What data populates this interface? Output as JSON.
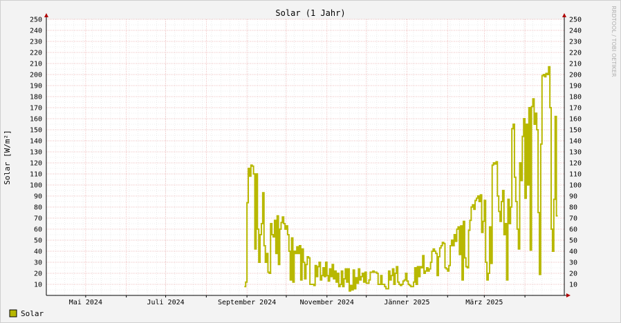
{
  "window": {
    "watermark": "RRDTOOL / TOBI OETIKER"
  },
  "colors": {
    "background": "#f3f3f3",
    "plot_bg": "#ffffff",
    "grid_major": "#e8a0a0",
    "grid_minor": "#dedede",
    "series": "#b8b800",
    "axis": "#000000",
    "arrow": "#b00000"
  },
  "chart_data": {
    "type": "line",
    "title": "Solar (1 Jahr)",
    "xlabel": "",
    "ylabel": "Solar [W/m²]",
    "ylim": [
      0,
      250
    ],
    "xlim": [
      "2024-04-01",
      "2025-05-01"
    ],
    "yticks": [
      10,
      20,
      30,
      40,
      50,
      60,
      70,
      80,
      90,
      100,
      110,
      120,
      130,
      140,
      150,
      160,
      170,
      180,
      190,
      200,
      210,
      220,
      230,
      240,
      250
    ],
    "xticks": [
      {
        "label": "Mai 2024",
        "date": "2024-05-01"
      },
      {
        "label": "Juli 2024",
        "date": "2024-07-01"
      },
      {
        "label": "September 2024",
        "date": "2024-09-01"
      },
      {
        "label": "November 2024",
        "date": "2024-11-01"
      },
      {
        "label": "Jänner 2025",
        "date": "2025-01-01"
      },
      {
        "label": "März 2025",
        "date": "2025-03-01"
      }
    ],
    "grid": true,
    "legend_position": "bottom-left",
    "series": [
      {
        "name": "Solar",
        "color": "#b8b800",
        "points": [
          [
            "2024-08-30",
            8
          ],
          [
            "2024-08-31",
            12
          ],
          [
            "2024-09-01",
            84
          ],
          [
            "2024-09-02",
            115
          ],
          [
            "2024-09-03",
            108
          ],
          [
            "2024-09-04",
            118
          ],
          [
            "2024-09-05",
            117
          ],
          [
            "2024-09-06",
            110
          ],
          [
            "2024-09-07",
            42
          ],
          [
            "2024-09-08",
            110
          ],
          [
            "2024-09-09",
            60
          ],
          [
            "2024-09-10",
            30
          ],
          [
            "2024-09-11",
            55
          ],
          [
            "2024-09-12",
            65
          ],
          [
            "2024-09-13",
            93
          ],
          [
            "2024-09-14",
            45
          ],
          [
            "2024-09-15",
            30
          ],
          [
            "2024-09-16",
            38
          ],
          [
            "2024-09-17",
            21
          ],
          [
            "2024-09-18",
            20
          ],
          [
            "2024-09-19",
            65
          ],
          [
            "2024-09-20",
            55
          ],
          [
            "2024-09-21",
            53
          ],
          [
            "2024-09-22",
            68
          ],
          [
            "2024-09-23",
            38
          ],
          [
            "2024-09-24",
            72
          ],
          [
            "2024-09-25",
            28
          ],
          [
            "2024-09-26",
            60
          ],
          [
            "2024-09-27",
            66
          ],
          [
            "2024-09-28",
            71
          ],
          [
            "2024-09-29",
            65
          ],
          [
            "2024-09-30",
            60
          ],
          [
            "2024-10-01",
            63
          ],
          [
            "2024-10-02",
            55
          ],
          [
            "2024-10-03",
            40
          ],
          [
            "2024-10-04",
            14
          ],
          [
            "2024-10-05",
            52
          ],
          [
            "2024-10-06",
            12
          ],
          [
            "2024-10-07",
            40
          ],
          [
            "2024-10-08",
            38
          ],
          [
            "2024-10-09",
            44
          ],
          [
            "2024-10-10",
            38
          ],
          [
            "2024-10-11",
            45
          ],
          [
            "2024-10-12",
            14
          ],
          [
            "2024-10-13",
            42
          ],
          [
            "2024-10-14",
            30
          ],
          [
            "2024-10-15",
            15
          ],
          [
            "2024-10-16",
            28
          ],
          [
            "2024-10-17",
            35
          ],
          [
            "2024-10-18",
            34
          ],
          [
            "2024-10-19",
            10
          ],
          [
            "2024-10-20",
            10
          ],
          [
            "2024-10-21",
            10
          ],
          [
            "2024-10-22",
            9
          ],
          [
            "2024-10-23",
            27
          ],
          [
            "2024-10-24",
            17
          ],
          [
            "2024-10-25",
            26
          ],
          [
            "2024-10-26",
            30
          ],
          [
            "2024-10-27",
            14
          ],
          [
            "2024-10-28",
            18
          ],
          [
            "2024-10-29",
            25
          ],
          [
            "2024-10-30",
            17
          ],
          [
            "2024-10-31",
            30
          ],
          [
            "2024-11-01",
            18
          ],
          [
            "2024-11-02",
            13
          ],
          [
            "2024-11-03",
            24
          ],
          [
            "2024-11-04",
            17
          ],
          [
            "2024-11-05",
            28
          ],
          [
            "2024-11-06",
            15
          ],
          [
            "2024-11-07",
            22
          ],
          [
            "2024-11-08",
            12
          ],
          [
            "2024-11-09",
            20
          ],
          [
            "2024-11-10",
            8
          ],
          [
            "2024-11-11",
            10
          ],
          [
            "2024-11-12",
            22
          ],
          [
            "2024-11-13",
            8
          ],
          [
            "2024-11-14",
            15
          ],
          [
            "2024-11-15",
            24
          ],
          [
            "2024-11-16",
            12
          ],
          [
            "2024-11-17",
            24
          ],
          [
            "2024-11-18",
            4
          ],
          [
            "2024-11-19",
            9
          ],
          [
            "2024-11-20",
            5
          ],
          [
            "2024-11-21",
            23
          ],
          [
            "2024-11-22",
            6
          ],
          [
            "2024-11-23",
            16
          ],
          [
            "2024-11-24",
            11
          ],
          [
            "2024-11-25",
            24
          ],
          [
            "2024-11-26",
            14
          ],
          [
            "2024-11-27",
            17
          ],
          [
            "2024-11-28",
            20
          ],
          [
            "2024-11-29",
            12
          ],
          [
            "2024-11-30",
            21
          ],
          [
            "2024-12-01",
            11
          ],
          [
            "2024-12-02",
            11
          ],
          [
            "2024-12-03",
            14
          ],
          [
            "2024-12-04",
            21
          ],
          [
            "2024-12-05",
            21
          ],
          [
            "2024-12-06",
            22
          ],
          [
            "2024-12-07",
            21
          ],
          [
            "2024-12-08",
            21
          ],
          [
            "2024-12-09",
            20
          ],
          [
            "2024-12-10",
            10
          ],
          [
            "2024-12-11",
            10
          ],
          [
            "2024-12-12",
            18
          ],
          [
            "2024-12-13",
            10
          ],
          [
            "2024-12-14",
            10
          ],
          [
            "2024-12-15",
            8
          ],
          [
            "2024-12-16",
            6
          ],
          [
            "2024-12-17",
            6
          ],
          [
            "2024-12-18",
            22
          ],
          [
            "2024-12-19",
            14
          ],
          [
            "2024-12-20",
            18
          ],
          [
            "2024-12-21",
            24
          ],
          [
            "2024-12-22",
            10
          ],
          [
            "2024-12-23",
            20
          ],
          [
            "2024-12-24",
            26
          ],
          [
            "2024-12-25",
            12
          ],
          [
            "2024-12-26",
            10
          ],
          [
            "2024-12-27",
            9
          ],
          [
            "2024-12-28",
            10
          ],
          [
            "2024-12-29",
            13
          ],
          [
            "2024-12-30",
            14
          ],
          [
            "2024-12-31",
            20
          ],
          [
            "2025-01-01",
            13
          ],
          [
            "2025-01-02",
            10
          ],
          [
            "2025-01-03",
            9
          ],
          [
            "2025-01-04",
            8
          ],
          [
            "2025-01-05",
            8
          ],
          [
            "2025-01-06",
            12
          ],
          [
            "2025-01-07",
            25
          ],
          [
            "2025-01-08",
            10
          ],
          [
            "2025-01-09",
            26
          ],
          [
            "2025-01-10",
            17
          ],
          [
            "2025-01-11",
            26
          ],
          [
            "2025-01-12",
            25
          ],
          [
            "2025-01-13",
            36
          ],
          [
            "2025-01-14",
            20
          ],
          [
            "2025-01-15",
            22
          ],
          [
            "2025-01-16",
            25
          ],
          [
            "2025-01-17",
            22
          ],
          [
            "2025-01-18",
            24
          ],
          [
            "2025-01-19",
            30
          ],
          [
            "2025-01-20",
            40
          ],
          [
            "2025-01-21",
            42
          ],
          [
            "2025-01-22",
            40
          ],
          [
            "2025-01-23",
            38
          ],
          [
            "2025-01-24",
            18
          ],
          [
            "2025-01-25",
            35
          ],
          [
            "2025-01-26",
            43
          ],
          [
            "2025-01-27",
            45
          ],
          [
            "2025-01-28",
            48
          ],
          [
            "2025-01-29",
            47
          ],
          [
            "2025-01-30",
            25
          ],
          [
            "2025-01-31",
            24
          ],
          [
            "2025-02-01",
            22
          ],
          [
            "2025-02-02",
            27
          ],
          [
            "2025-02-03",
            45
          ],
          [
            "2025-02-04",
            50
          ],
          [
            "2025-02-05",
            45
          ],
          [
            "2025-02-06",
            55
          ],
          [
            "2025-02-07",
            49
          ],
          [
            "2025-02-08",
            60
          ],
          [
            "2025-02-09",
            62
          ],
          [
            "2025-02-10",
            37
          ],
          [
            "2025-02-11",
            63
          ],
          [
            "2025-02-12",
            14
          ],
          [
            "2025-02-13",
            67
          ],
          [
            "2025-02-14",
            34
          ],
          [
            "2025-02-15",
            26
          ],
          [
            "2025-02-16",
            25
          ],
          [
            "2025-02-17",
            59
          ],
          [
            "2025-02-18",
            68
          ],
          [
            "2025-02-19",
            80
          ],
          [
            "2025-02-20",
            82
          ],
          [
            "2025-02-21",
            78
          ],
          [
            "2025-02-22",
            86
          ],
          [
            "2025-02-23",
            88
          ],
          [
            "2025-02-24",
            90
          ],
          [
            "2025-02-25",
            85
          ],
          [
            "2025-02-26",
            91
          ],
          [
            "2025-02-27",
            57
          ],
          [
            "2025-02-28",
            67
          ],
          [
            "2025-03-01",
            86
          ],
          [
            "2025-03-02",
            30
          ],
          [
            "2025-03-03",
            14
          ],
          [
            "2025-03-04",
            20
          ],
          [
            "2025-03-05",
            62
          ],
          [
            "2025-03-06",
            29
          ],
          [
            "2025-03-07",
            118
          ],
          [
            "2025-03-08",
            120
          ],
          [
            "2025-03-09",
            119
          ],
          [
            "2025-03-10",
            121
          ],
          [
            "2025-03-11",
            90
          ],
          [
            "2025-03-12",
            76
          ],
          [
            "2025-03-13",
            67
          ],
          [
            "2025-03-14",
            85
          ],
          [
            "2025-03-15",
            95
          ],
          [
            "2025-03-16",
            55
          ],
          [
            "2025-03-17",
            65
          ],
          [
            "2025-03-18",
            14
          ],
          [
            "2025-03-19",
            87
          ],
          [
            "2025-03-20",
            65
          ],
          [
            "2025-03-21",
            80
          ],
          [
            "2025-03-22",
            151
          ],
          [
            "2025-03-23",
            155
          ],
          [
            "2025-03-24",
            107
          ],
          [
            "2025-03-25",
            85
          ],
          [
            "2025-03-26",
            60
          ],
          [
            "2025-03-27",
            42
          ],
          [
            "2025-03-28",
            120
          ],
          [
            "2025-03-29",
            104
          ],
          [
            "2025-03-30",
            144
          ],
          [
            "2025-03-31",
            160
          ],
          [
            "2025-04-01",
            88
          ],
          [
            "2025-04-02",
            155
          ],
          [
            "2025-04-03",
            100
          ],
          [
            "2025-04-04",
            170
          ],
          [
            "2025-04-05",
            41
          ],
          [
            "2025-04-06",
            171
          ],
          [
            "2025-04-07",
            178
          ],
          [
            "2025-04-08",
            155
          ],
          [
            "2025-04-09",
            165
          ],
          [
            "2025-04-10",
            150
          ],
          [
            "2025-04-11",
            75
          ],
          [
            "2025-04-12",
            19
          ],
          [
            "2025-04-13",
            137
          ],
          [
            "2025-04-14",
            199
          ],
          [
            "2025-04-15",
            200
          ],
          [
            "2025-04-16",
            198
          ],
          [
            "2025-04-17",
            201
          ],
          [
            "2025-04-18",
            200
          ],
          [
            "2025-04-19",
            207
          ],
          [
            "2025-04-20",
            170
          ],
          [
            "2025-04-21",
            60
          ],
          [
            "2025-04-22",
            40
          ],
          [
            "2025-04-23",
            87
          ],
          [
            "2025-04-24",
            162
          ],
          [
            "2025-04-25",
            72
          ]
        ]
      }
    ]
  }
}
